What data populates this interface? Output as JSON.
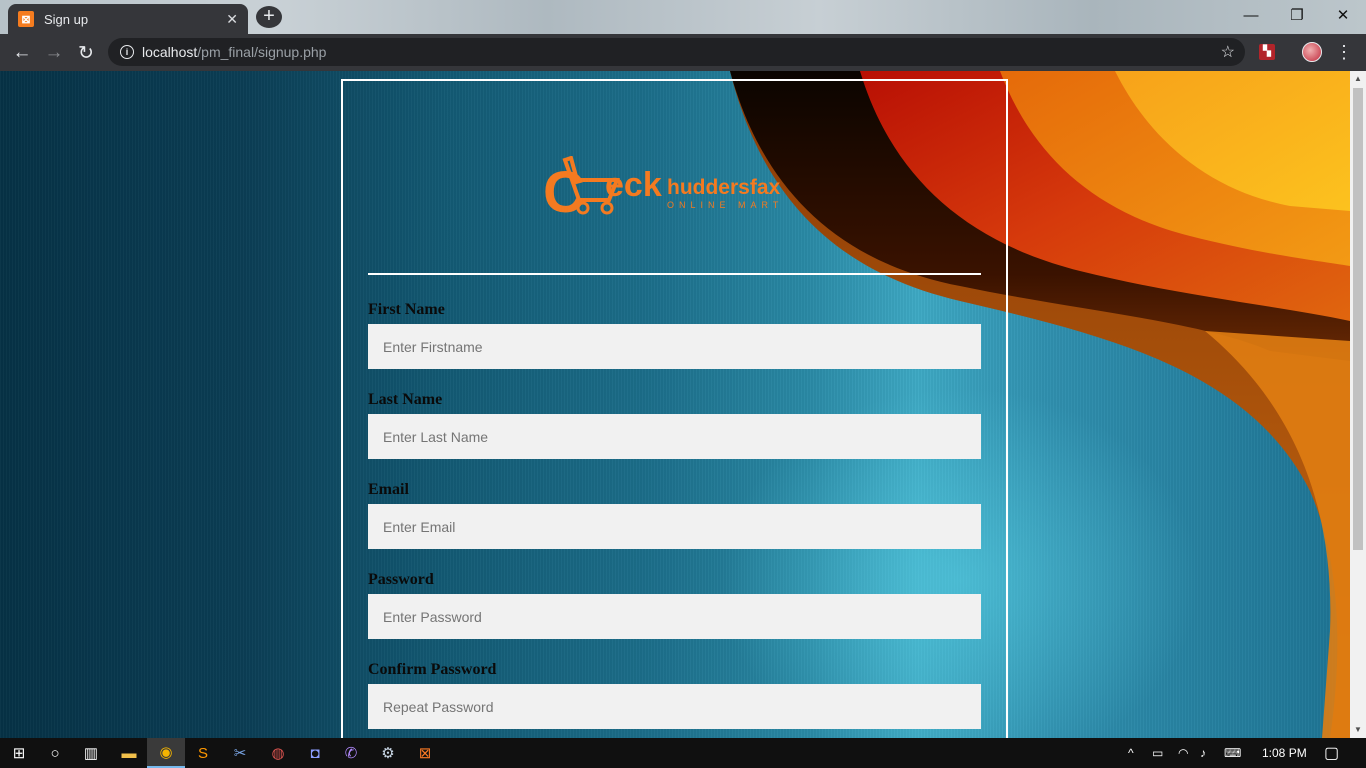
{
  "browser": {
    "tab_title": "Sign up",
    "tab_favicon": "xampp-icon",
    "tab_close": "✕",
    "new_tab": "+",
    "url_host": "localhost",
    "url_path": "/pm_final/signup.php",
    "window_controls": {
      "minimize": "—",
      "restore": "❐",
      "close": "✕"
    }
  },
  "logo": {
    "brand_prefix": "C",
    "brand_mid": "eck",
    "brand_suffix": "huddersfax",
    "tagline": "ONLINE MART"
  },
  "form": {
    "fields": [
      {
        "label": "First Name",
        "placeholder": "Enter Firstname"
      },
      {
        "label": "Last Name",
        "placeholder": "Enter Last Name"
      },
      {
        "label": "Email",
        "placeholder": "Enter Email"
      },
      {
        "label": "Password",
        "placeholder": "Enter Password"
      },
      {
        "label": "Confirm Password",
        "placeholder": "Repeat Password"
      }
    ]
  },
  "taskbar": {
    "clock": "1:08 PM",
    "apps": [
      "windows-start-icon",
      "cortana-icon",
      "task-view-icon",
      "file-explorer-icon",
      "chrome-icon",
      "sublime-text-icon",
      "snipping-tool-icon",
      "filezilla-icon",
      "discord-icon",
      "viber-icon",
      "steam-icon",
      "xampp-icon"
    ]
  },
  "colors": {
    "panel_border": "#ffffff",
    "input_bg": "#f1f1f1",
    "logo_orange": "#f47a20",
    "wave_red": "#d42a08",
    "wave_orange": "#f08a12",
    "wave_yellow": "#fbb71c"
  }
}
